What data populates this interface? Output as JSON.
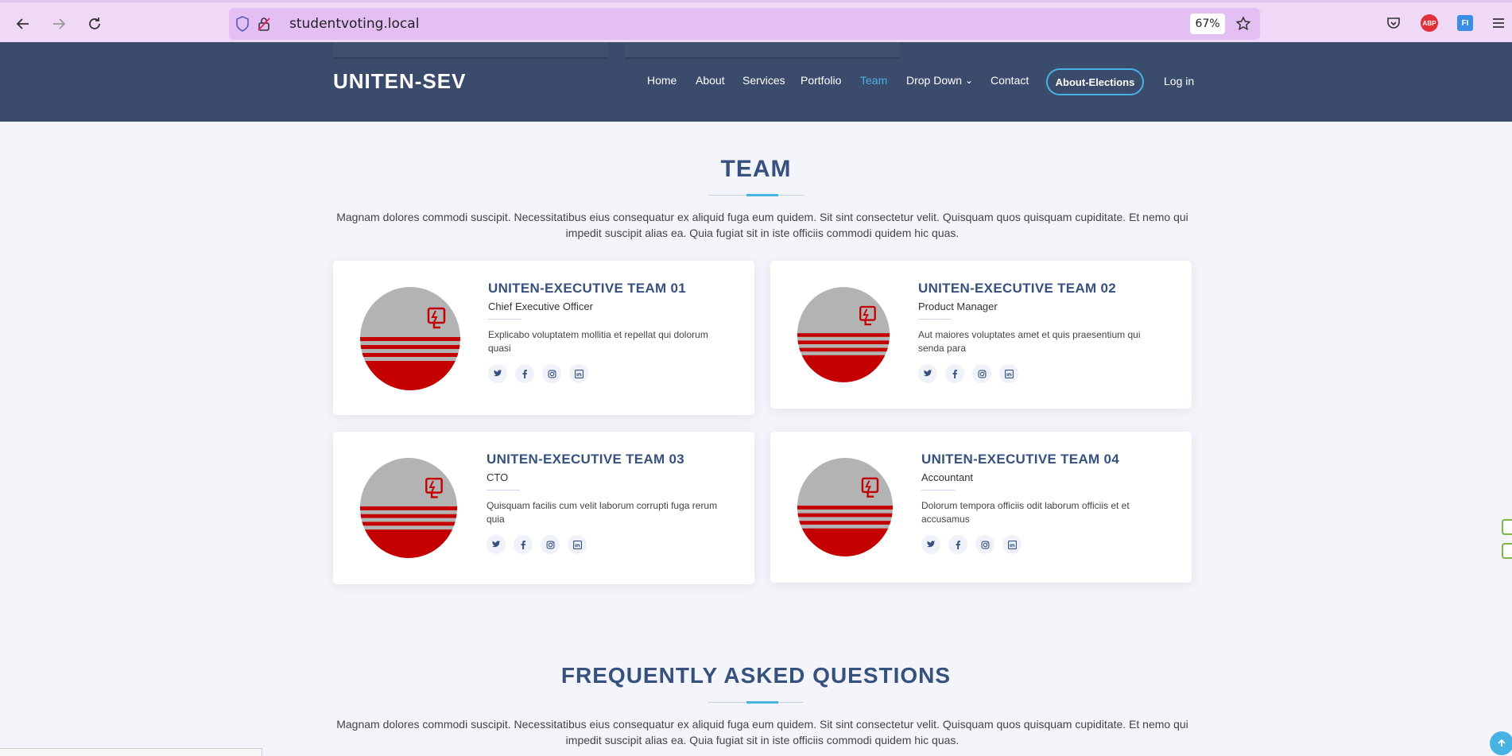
{
  "browser": {
    "url": "studentvoting.local",
    "zoom": "67%",
    "icons": [
      "back-arrow-icon",
      "forward-arrow-icon",
      "reload-icon",
      "shield-icon",
      "lock-icon",
      "bookmark-star-icon",
      "pocket-icon",
      "adblock-icon",
      "translate-icon",
      "menu-icon"
    ],
    "adblock_label": "ABP",
    "translate_label": "FI"
  },
  "header": {
    "logo": "UNITEN-SEV",
    "menu": [
      "Home",
      "About",
      "Services",
      "Portfolio",
      "Team",
      "Drop Down",
      "Contact"
    ],
    "active_item": "Team",
    "dropdown_caret": "⌄",
    "cta": "About-Elections",
    "login": "Log in"
  },
  "team": {
    "title": "TEAM",
    "description": "Magnam dolores commodi suscipit. Necessitatibus eius consequatur ex aliquid fuga eum quidem. Sit sint consectetur velit. Quisquam quos quisquam cupiditate. Et nemo qui impedit suscipit alias ea. Quia fugiat sit in iste officiis commodi quidem hic quas.",
    "members": [
      {
        "name": "UNITEN-EXECUTIVE TEAM 01",
        "role": "Chief Executive Officer",
        "bio": "Explicabo voluptatem mollitia et repellat qui dolorum quasi"
      },
      {
        "name": "UNITEN-EXECUTIVE TEAM 02",
        "role": "Product Manager",
        "bio": "Aut maiores voluptates amet et quis praesentium qui senda para"
      },
      {
        "name": "UNITEN-EXECUTIVE TEAM 03",
        "role": "CTO",
        "bio": "Quisquam facilis cum velit laborum corrupti fuga rerum quia"
      },
      {
        "name": "UNITEN-EXECUTIVE TEAM 04",
        "role": "Accountant",
        "bio": "Dolorum tempora officiis odit laborum officiis et et accusamus"
      }
    ],
    "social_icons": [
      "twitter-icon",
      "facebook-icon",
      "instagram-icon",
      "linkedin-icon"
    ]
  },
  "faq": {
    "title": "FREQUENTLY ASKED QUESTIONS",
    "description": "Magnam dolores commodi suscipit. Necessitatibus eius consequatur ex aliquid fuga eum quidem. Sit sint consectetur velit. Quisquam quos quisquam cupiditate. Et nemo qui impedit suscipit alias ea. Quia fugiat sit in iste officiis commodi quidem hic quas."
  },
  "colors": {
    "header_bg": "#3b4b6b",
    "accent": "#47b2e4",
    "heading": "#37517e",
    "avatar_red": "#c40000",
    "avatar_grey": "#b3b3b3"
  }
}
